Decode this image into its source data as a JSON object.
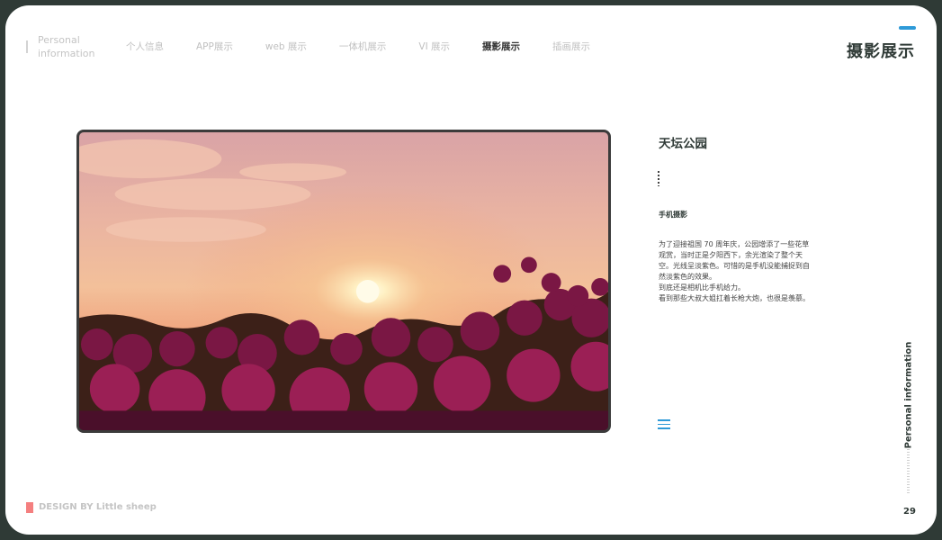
{
  "header": {
    "brand": "Personal information",
    "nav": [
      "个人信息",
      "APP展示",
      "web 展示",
      "一体机展示",
      "VI 展示",
      "摄影展示",
      "插画展示"
    ],
    "active_index": 5,
    "page_title": "摄影展示"
  },
  "content": {
    "location_title": "天坛公园",
    "device_label": "手机摄影",
    "description": [
      "为了迎接祖国 70 周年庆，公园增添了一些花草观赏，当时正是夕阳西下，余光渲染了整个天空。光线呈淡紫色。可惜的是手机没能捕捉到自然淡紫色的效果。",
      "到底还是相机比手机给力。",
      "看到那些大叔大姐扛着长枪大炮，也很是羡慕。"
    ]
  },
  "side": {
    "label": "Personal information",
    "page_number": "29"
  },
  "footer": {
    "credit": "DESIGN BY Little sheep"
  },
  "colors": {
    "accent_blue": "#2e9ad8",
    "footer_mark": "#f47f7f",
    "dark_text": "#2f3a36",
    "frame_bg": "#2f3a36"
  }
}
